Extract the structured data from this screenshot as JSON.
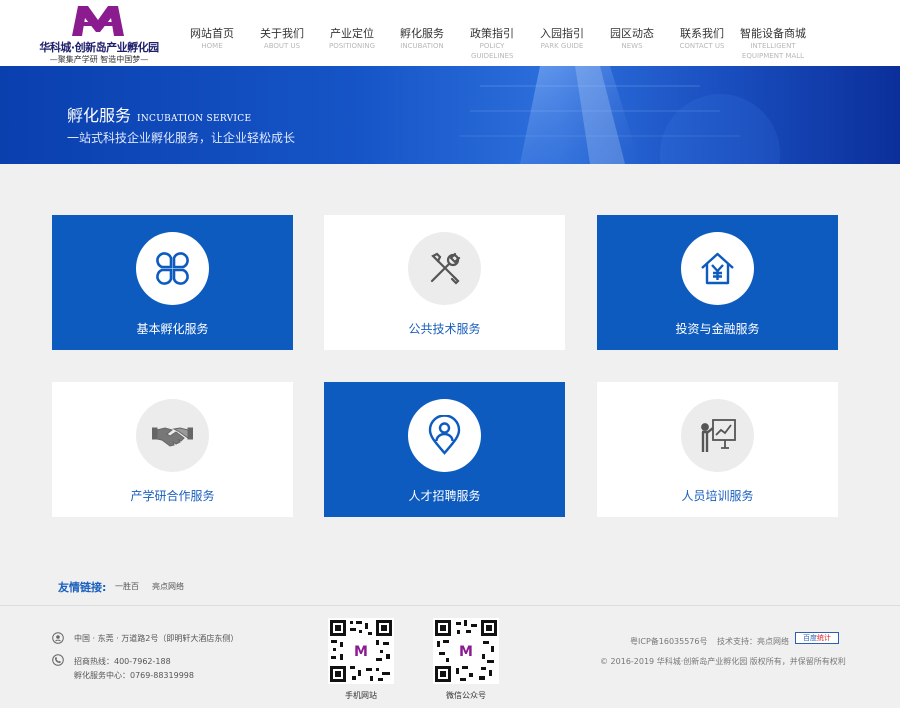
{
  "logo": {
    "mark": "M",
    "name": "华科城·创新岛产业孵化园",
    "slogan": "—聚集产学研  智造中国梦—"
  },
  "nav": [
    {
      "zh": "网站首页",
      "en": "HOME"
    },
    {
      "zh": "关于我们",
      "en": "ABOUT US"
    },
    {
      "zh": "产业定位",
      "en": "POSITIONING"
    },
    {
      "zh": "孵化服务",
      "en": "INCUBATION"
    },
    {
      "zh": "政策指引",
      "en": "POLICY GUIDELINES"
    },
    {
      "zh": "入园指引",
      "en": "PARK GUIDE"
    },
    {
      "zh": "园区动态",
      "en": "NEWS"
    },
    {
      "zh": "联系我们",
      "en": "CONTACT US"
    },
    {
      "zh": "智能设备商城",
      "en": "INTELLIGENT EQUIPMENT MALL"
    }
  ],
  "banner": {
    "title": "孵化服务",
    "subtitle": "INCUBATION SERVICE",
    "desc": "一站式科技企业孵化服务，让企业轻松成长"
  },
  "services": [
    {
      "label": "基本孵化服务",
      "icon": "clover-icon",
      "style": "blue"
    },
    {
      "label": "公共技术服务",
      "icon": "wrench-screwdriver-icon",
      "style": "white"
    },
    {
      "label": "投资与金融服务",
      "icon": "house-yen-icon",
      "style": "blue"
    },
    {
      "label": "产学研合作服务",
      "icon": "handshake-icon",
      "style": "white"
    },
    {
      "label": "人才招聘服务",
      "icon": "person-location-icon",
      "style": "blue"
    },
    {
      "label": "人员培训服务",
      "icon": "presentation-board-icon",
      "style": "white"
    }
  ],
  "links": {
    "title": "友情链接:",
    "items": [
      "一胜百",
      "亮点网络"
    ]
  },
  "footer": {
    "address": "中国 · 东莞 · 万道路2号（即明轩大酒店东侧）",
    "hotline": "招商热线：400-7962-188",
    "incubation_phone": "孵化服务中心：0769-88319998",
    "qr": [
      {
        "caption": "手机网站"
      },
      {
        "caption": "微信公众号"
      }
    ],
    "icp": "粤ICP备16035576号",
    "tech_support": "技术支持：亮点网络",
    "copyright": "© 2016-2019 华科城·创新岛产业孵化园 版权所有，并保留所有权利",
    "baidu_stat": {
      "part1": "百度",
      "part2": "统计"
    }
  },
  "colors": {
    "brand_blue": "#0d5bbf",
    "logo_purple": "#8a1c8f",
    "link_blue": "#1a5fbf"
  }
}
